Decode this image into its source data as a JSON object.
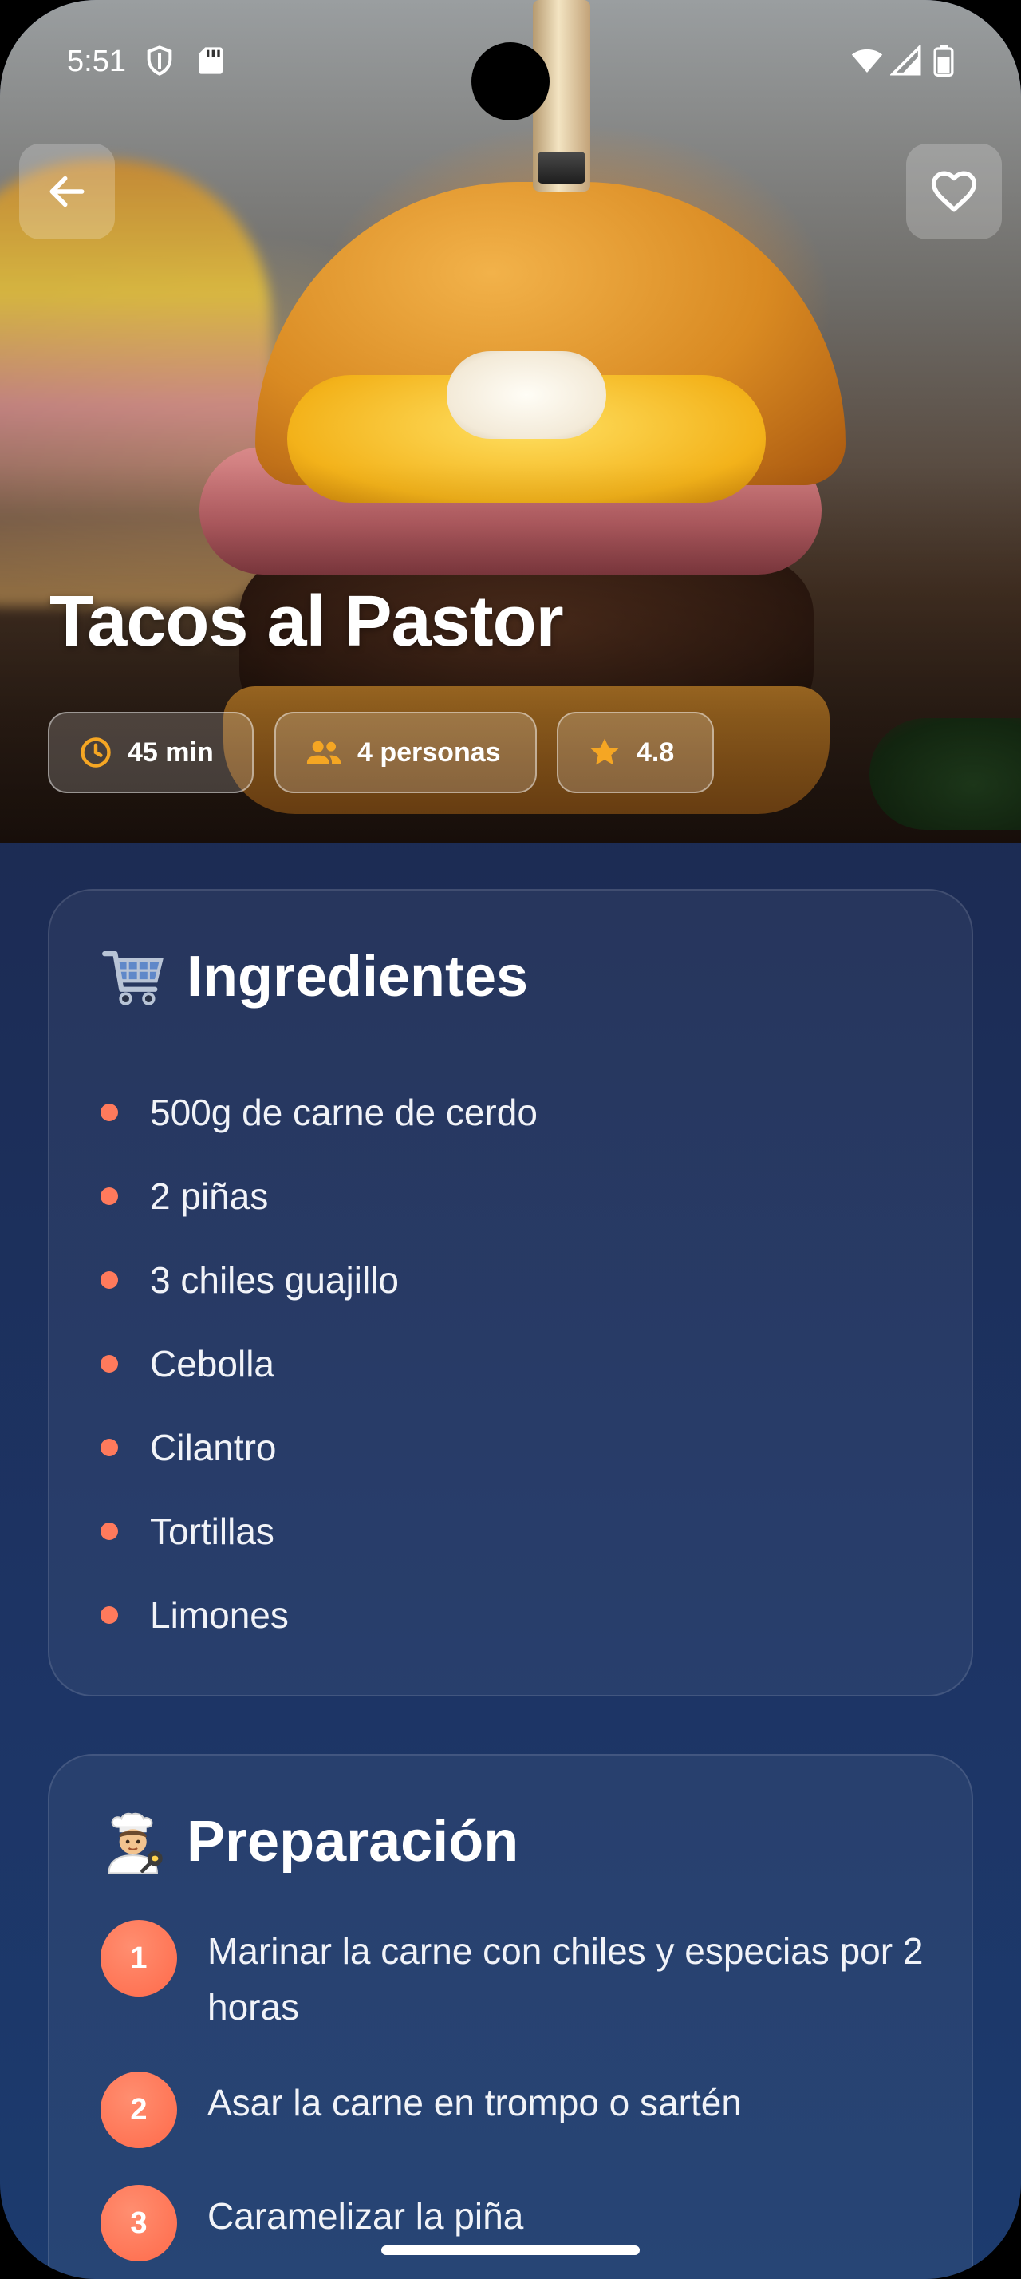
{
  "status_bar": {
    "time": "5:51",
    "icons": [
      "shield-icon",
      "sd-card-icon",
      "wifi-icon",
      "signal-icon",
      "battery-icon"
    ]
  },
  "header": {
    "back_icon": "arrow-back-icon",
    "favorite_icon": "heart-outline-icon"
  },
  "recipe": {
    "title": "Tacos al Pastor",
    "chips": {
      "time": {
        "icon": "clock-icon",
        "label": "45 min"
      },
      "servings": {
        "icon": "people-icon",
        "label": "4 personas"
      },
      "rating": {
        "icon": "star-icon",
        "label": "4.8"
      }
    }
  },
  "ingredients": {
    "icon": "shopping-cart-emoji-icon",
    "title": "Ingredientes",
    "items": [
      "500g de carne de cerdo",
      "2 piñas",
      "3 chiles guajillo",
      "Cebolla",
      "Cilantro",
      "Tortillas",
      "Limones"
    ]
  },
  "preparation": {
    "icon": "cook-emoji-icon",
    "title": "Preparación",
    "steps": [
      {
        "number": "1",
        "text": "Marinar la carne con chiles y especias por 2 horas"
      },
      {
        "number": "2",
        "text": "Asar la carne en trompo o sartén"
      },
      {
        "number": "3",
        "text": "Caramelizar la piña"
      }
    ]
  },
  "colors": {
    "accent": "#FF7A5C",
    "chip_icon": "#F5A623",
    "background_top": "#16244A",
    "background_bottom": "#1C3B6E"
  }
}
